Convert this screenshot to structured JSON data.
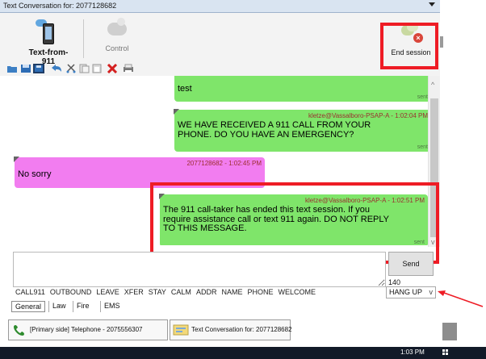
{
  "window": {
    "title": "Text Conversation for: 2077128682"
  },
  "toolbar": {
    "text_from_911_label": "Text-from-911",
    "control_label": "Control",
    "end_session_label": "End session",
    "icons": [
      "open-folder-icon",
      "save-icon",
      "save-all-icon",
      "undo-icon",
      "cut-icon",
      "copy-icon",
      "paste-icon",
      "delete-icon",
      "print-icon"
    ]
  },
  "messages": [
    {
      "sender": "",
      "text": "test",
      "status": "sent",
      "color": "#7fe56a"
    },
    {
      "sender": "kletze@Vassalboro-PSAP-A - 1:02:04 PM",
      "text": "WE HAVE RECEIVED A 911 CALL FROM YOUR PHONE. DO YOU HAVE AN EMERGENCY?",
      "status": "sent",
      "color": "#7fe56a"
    },
    {
      "sender": "2077128682 - 1:02:45 PM",
      "text": "No sorry",
      "status": "",
      "color": "#f27df0"
    },
    {
      "sender": "kletze@Vassalboro-PSAP-A - 1:02:51 PM",
      "text": "The 911 call-taker has ended this text session. If you require assistance call or text 911 again. DO NOT REPLY TO THIS MESSAGE.",
      "status": "sent",
      "color": "#7fe56a"
    }
  ],
  "compose": {
    "value": "",
    "send_label": "Send",
    "char_count": "140"
  },
  "shortcuts": [
    "CALL911",
    "OUTBOUND",
    "LEAVE",
    "XFER",
    "STAY",
    "CALM",
    "ADDR",
    "NAME",
    "PHONE",
    "WELCOME"
  ],
  "hangup": {
    "selected": "HANG UP"
  },
  "tabs": [
    "General",
    "Law",
    "Fire",
    "EMS"
  ],
  "tasks": [
    {
      "label": "[Primary side] Telephone - 2075556307",
      "icon": "phone-handset-icon"
    },
    {
      "label": "Text Conversation for: 2077128682",
      "icon": "chat-window-icon"
    }
  ],
  "system_tray": {
    "time": "1:03 PM"
  },
  "highlight_color": "#ee1c25"
}
